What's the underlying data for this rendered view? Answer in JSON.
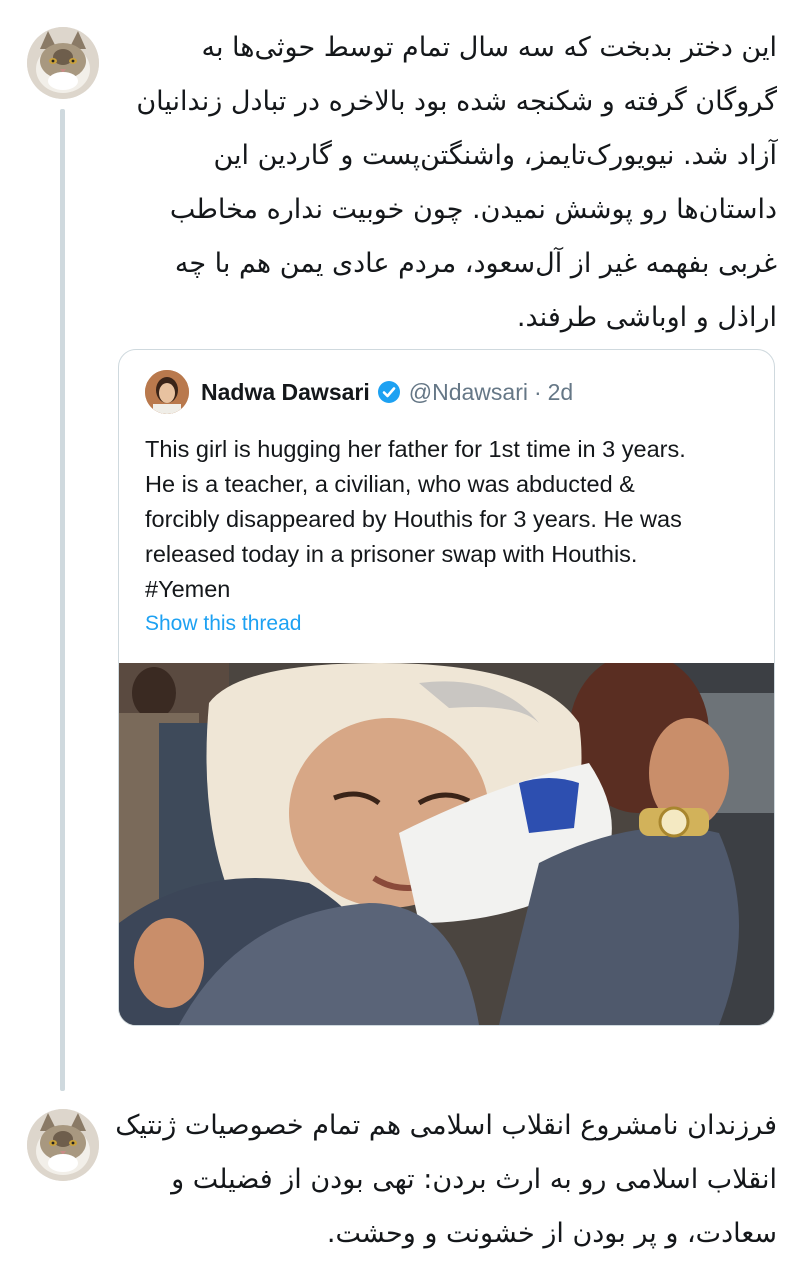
{
  "thread": {
    "tweet_1": {
      "avatar_icon": "cat-avatar-icon",
      "text": "این دختر بدبخت که سه سال تمام توسط حوثی‌ها به گروگان گرفته و شکنجه شده بود بالاخره در تبادل زندانیان آزاد شد. نیویورک‌تایمز، واشنگتن‌پست و گاردین این داستان‌ها رو پوشش نمیدن. چون خوبیت نداره مخاطب غربی بفهمه غیر از آل‌سعود، مردم عادی یمن هم با چه اراذل و اوباشی طرفند."
    },
    "quoted_tweet": {
      "author_name": "Nadwa Dawsari",
      "verified_icon": "verified-badge-icon",
      "handle": "@Ndawsari",
      "separator": "·",
      "time": "2d",
      "text": "This girl is hugging her father for 1st time in 3 years.\nHe is a teacher, a civilian, who was abducted &\nforcibly disappeared by Houthis for 3 years. He was\nreleased today in a prisoner swap with Houthis.\n#Yemen",
      "show_thread_label": "Show this thread",
      "photo": "hugging-photo"
    },
    "tweet_2": {
      "avatar_icon": "cat-avatar-icon",
      "text": "فرزندان نامشروع انقلاب اسلامی هم تمام خصوصیات ژنتیک انقلاب اسلامی رو به ارث بردن: تهی بودن از فضیلت و سعادت، و پر بودن از خشونت و وحشت."
    }
  },
  "colors": {
    "text": "#14171a",
    "secondary": "#657786",
    "link": "#1da1f2",
    "border": "#cfd9de",
    "thread_line": "#cfd9de"
  }
}
